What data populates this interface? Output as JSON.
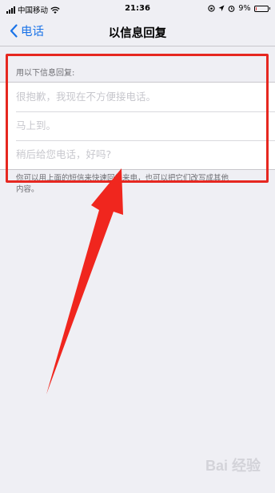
{
  "status_bar": {
    "carrier": "中国移动",
    "time": "21:36",
    "battery": "9%",
    "battery_level": 0.09,
    "icons": [
      "signal-icon",
      "wifi-icon",
      "orientation-lock-icon",
      "location-icon",
      "alarm-icon",
      "battery-icon"
    ]
  },
  "nav": {
    "back_label": "电话",
    "title": "以信息回复"
  },
  "section": {
    "header": "用以下信息回复:",
    "rows": [
      "很抱歉，我现在不方便接电话。",
      "马上到。",
      "稍后给您电话，好吗?"
    ],
    "footer": "你可以用上面的短信来快速回复来电，也可以把它们改写成其他内容。"
  },
  "annotation": {
    "box_color": "#e62720",
    "arrow_color": "#f0261e"
  },
  "watermark": "Bai 经验"
}
